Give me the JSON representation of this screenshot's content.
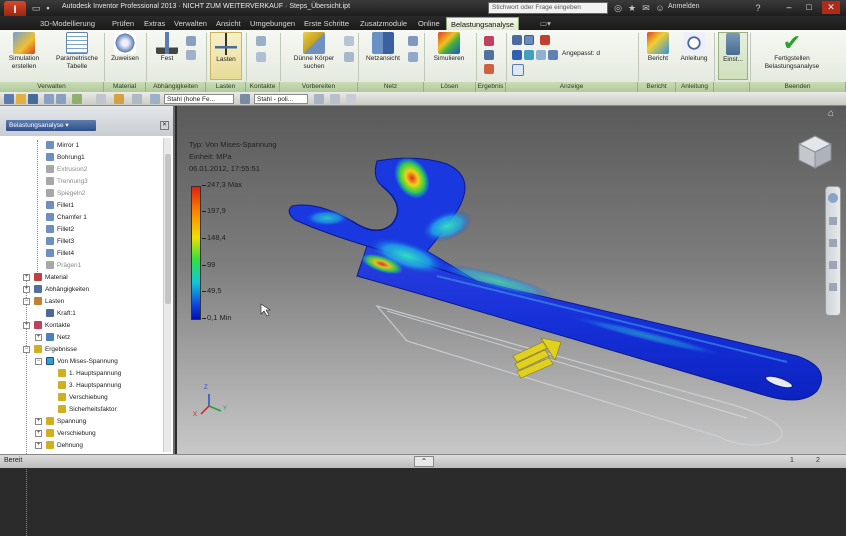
{
  "window": {
    "title": "Autodesk Inventor Professional 2013 · NICHT ZUM WEITERVERKAUF · Steps_Übersicht.ipt",
    "search_placeholder": "Stichwort oder Frage eingeben",
    "user": "Anmelden"
  },
  "tabs": [
    {
      "label": "3D-Modellierung",
      "active": false
    },
    {
      "label": "Prüfen",
      "active": false
    },
    {
      "label": "Extras",
      "active": false
    },
    {
      "label": "Verwalten",
      "active": false
    },
    {
      "label": "Ansicht",
      "active": false
    },
    {
      "label": "Umgebungen",
      "active": false
    },
    {
      "label": "Erste Schritte",
      "active": false
    },
    {
      "label": "Zusatzmodule",
      "active": false
    },
    {
      "label": "Online",
      "active": false
    },
    {
      "label": "Belastungsanalyse",
      "active": true
    }
  ],
  "ribbon": {
    "buttons": {
      "sim_create": "Simulation erstellen",
      "param_table": "Parametrische Tabelle",
      "assign": "Zuweisen",
      "fixed": "Fest",
      "loads": "Lasten",
      "find_thin": "Dünne Körper suchen",
      "mesh_view": "Netzansicht",
      "simulate": "Simulieren",
      "adjust": "Angepasst: d",
      "report": "Bericht",
      "guide": "Anleitung",
      "settings": "Einst...",
      "finish": "Fertigstellen Belastungsanalyse"
    },
    "panels": {
      "manage": "Verwalten",
      "material": "Material",
      "constraints": "Abhängigkeiten",
      "loads": "Lasten",
      "contacts": "Kontakte",
      "prepare": "Vorbereiten",
      "mesh": "Netz",
      "solve": "Lösen",
      "result": "Ergebnis",
      "display": "Anzeige",
      "report": "Bericht",
      "guide": "Anleitung",
      "settings": "",
      "exit": "Beenden"
    }
  },
  "toolbar": {
    "material_combo": "Stahl (hohe Fe...",
    "appearance_combo": "Stahl - poli..."
  },
  "browser": {
    "header": "Belastungsanalyse ▾",
    "items": [
      {
        "label": "Mirror 1",
        "faded": false,
        "icon": "feature"
      },
      {
        "label": "Bohrung1",
        "faded": false,
        "icon": "feature"
      },
      {
        "label": "Extrusion2",
        "faded": true,
        "icon": "sketch"
      },
      {
        "label": "Trennung3",
        "faded": true,
        "icon": "sketch"
      },
      {
        "label": "Spiegeln2",
        "faded": true,
        "icon": "sketch"
      },
      {
        "label": "Fillet1",
        "faded": false,
        "icon": "feature"
      },
      {
        "label": "Chamfer 1",
        "faded": false,
        "icon": "feature"
      },
      {
        "label": "Fillet2",
        "faded": false,
        "icon": "feature"
      },
      {
        "label": "Fillet3",
        "faded": false,
        "icon": "feature"
      },
      {
        "label": "Fillet4",
        "faded": false,
        "icon": "feature"
      },
      {
        "label": "Prägen1",
        "faded": true,
        "icon": "sketch"
      },
      {
        "label": "Material",
        "faded": false,
        "icon": "material"
      },
      {
        "label": "Abhängigkeiten",
        "faded": false,
        "icon": "constraint"
      },
      {
        "label": "Lasten",
        "faded": false,
        "icon": "load"
      },
      {
        "label": "Kraft:1",
        "faded": false,
        "icon": "force"
      },
      {
        "label": "Kontakte",
        "faded": false,
        "icon": "contact"
      },
      {
        "label": "Netz",
        "faded": false,
        "icon": "mesh"
      },
      {
        "label": "Ergebnisse",
        "faded": false,
        "icon": "result"
      },
      {
        "label": "Von Mises-Spannung",
        "faded": false,
        "icon": "result-active"
      },
      {
        "label": "1. Hauptspannung",
        "faded": false,
        "icon": "result"
      },
      {
        "label": "3. Hauptspannung",
        "faded": false,
        "icon": "result"
      },
      {
        "label": "Verschiebung",
        "faded": false,
        "icon": "result"
      },
      {
        "label": "Sicherheitsfaktor",
        "faded": false,
        "icon": "result"
      },
      {
        "label": "Spannung",
        "faded": false,
        "icon": "result"
      },
      {
        "label": "Verschiebung",
        "faded": false,
        "icon": "result"
      },
      {
        "label": "Dehnung",
        "faded": false,
        "icon": "result"
      }
    ]
  },
  "viewport": {
    "result_title": "Typ: Von Mises-Spannung",
    "unit_line": "Einheit: MPa",
    "date_line": "06.01.2012, 17:55:51",
    "legend": [
      "247,3 Max",
      "197,9",
      "148,4",
      "99",
      "49,5",
      "0,1 Min"
    ],
    "axis_labels": {
      "x": "X",
      "y": "Y",
      "z": "Z"
    }
  },
  "status": {
    "text": "Bereit",
    "num1": "1",
    "num2": "2"
  }
}
